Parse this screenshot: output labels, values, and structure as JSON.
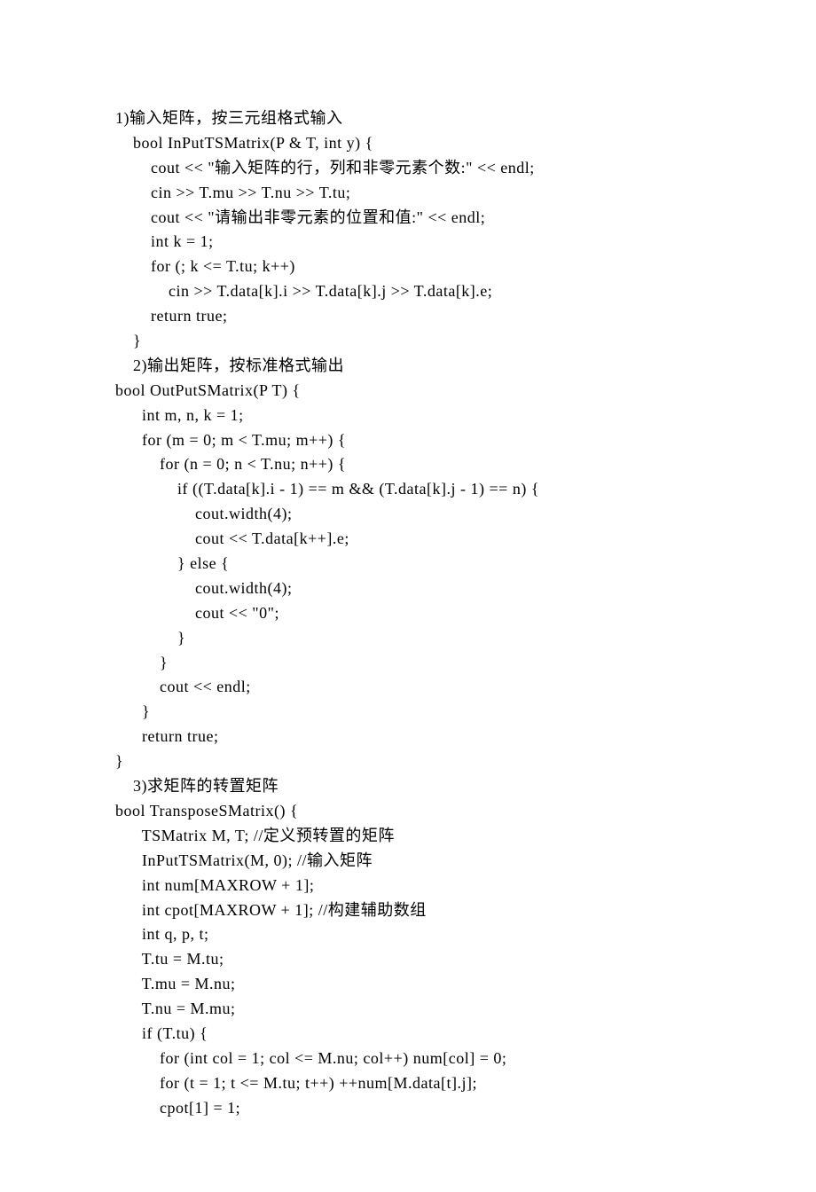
{
  "lines": [
    "1)输入矩阵，按三元组格式输入",
    "    bool InPutTSMatrix(P & T, int y) {",
    "        cout << \"输入矩阵的行，列和非零元素个数:\" << endl;",
    "        cin >> T.mu >> T.nu >> T.tu;",
    "        cout << \"请输出非零元素的位置和值:\" << endl;",
    "        int k = 1;",
    "        for (; k <= T.tu; k++)",
    "            cin >> T.data[k].i >> T.data[k].j >> T.data[k].e;",
    "        return true;",
    "    }",
    "    2)输出矩阵，按标准格式输出",
    "bool OutPutSMatrix(P T) {",
    "      int m, n, k = 1;",
    "      for (m = 0; m < T.mu; m++) {",
    "          for (n = 0; n < T.nu; n++) {",
    "              if ((T.data[k].i - 1) == m && (T.data[k].j - 1) == n) {",
    "                  cout.width(4);",
    "                  cout << T.data[k++].e;",
    "              } else {",
    "                  cout.width(4);",
    "                  cout << \"0\";",
    "              }",
    "          }",
    "          cout << endl;",
    "      }",
    "      return true;",
    "}",
    "    3)求矩阵的转置矩阵",
    "bool TransposeSMatrix() {",
    "      TSMatrix M, T; //定义预转置的矩阵",
    "      InPutTSMatrix(M, 0); //输入矩阵",
    "      int num[MAXROW + 1];",
    "      int cpot[MAXROW + 1]; //构建辅助数组",
    "      int q, p, t;",
    "      T.tu = M.tu;",
    "      T.mu = M.nu;",
    "      T.nu = M.mu;",
    "      if (T.tu) {",
    "          for (int col = 1; col <= M.nu; col++) num[col] = 0;",
    "          for (t = 1; t <= M.tu; t++) ++num[M.data[t].j];",
    "          cpot[1] = 1;"
  ]
}
